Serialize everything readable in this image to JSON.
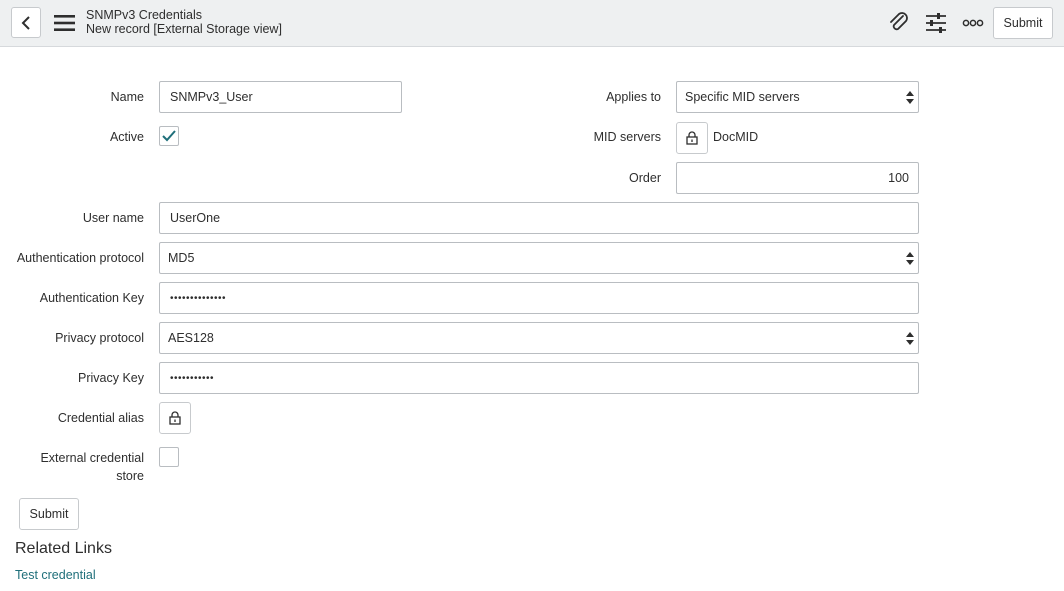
{
  "header": {
    "title": "SNMPv3 Credentials",
    "subtitle": "New record [External Storage view]",
    "submit_label": "Submit",
    "icons": [
      "back-icon",
      "menu-icon",
      "attachment-icon",
      "settings-sliders-icon",
      "more-options-icon"
    ]
  },
  "form": {
    "name": {
      "label": "Name",
      "value": "SNMPv3_User"
    },
    "active": {
      "label": "Active",
      "checked": true
    },
    "applies_to": {
      "label": "Applies to",
      "value": "Specific MID servers"
    },
    "mid_servers": {
      "label": "MID servers",
      "value": "DocMID"
    },
    "order": {
      "label": "Order",
      "value": "100"
    },
    "user_name": {
      "label": "User name",
      "value": "UserOne"
    },
    "auth_protocol": {
      "label": "Authentication protocol",
      "value": "MD5"
    },
    "auth_key": {
      "label": "Authentication Key",
      "value": "••••••••••••••"
    },
    "privacy_protocol": {
      "label": "Privacy protocol",
      "value": "AES128"
    },
    "privacy_key": {
      "label": "Privacy Key",
      "value": "•••••••••••"
    },
    "credential_alias": {
      "label": "Credential alias"
    },
    "external_store": {
      "label_line1": "External credential",
      "label_line2": "store",
      "checked": false
    },
    "submit_label": "Submit"
  },
  "related": {
    "heading": "Related Links",
    "links": [
      "Test credential"
    ]
  },
  "colors": {
    "accent": "#1f6f7a",
    "header_bg": "#eef0f1",
    "border": "#b9bdc1"
  }
}
